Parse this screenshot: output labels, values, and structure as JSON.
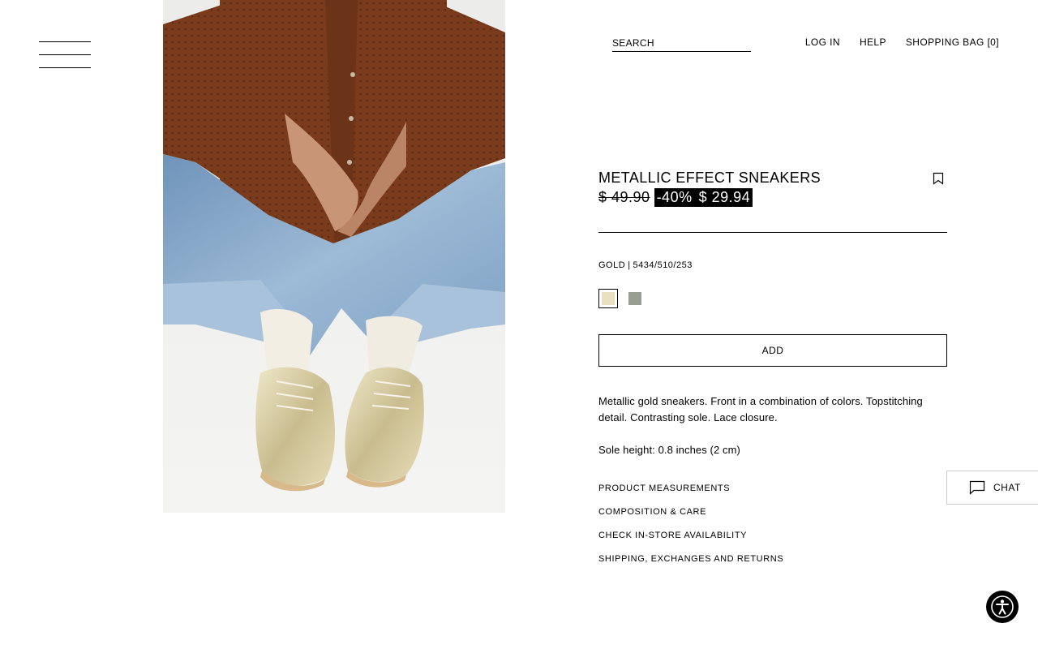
{
  "menu": {
    "icon": "hamburger-menu-icon"
  },
  "header": {
    "search_placeholder": "SEARCH",
    "login": "LOG IN",
    "help": "HELP",
    "bag": "SHOPPING BAG [0]"
  },
  "product": {
    "title": "METALLIC EFFECT SNEAKERS",
    "old_price": "$ 49.90",
    "discount": "-40%",
    "price": "$ 29.94",
    "color_name": "GOLD",
    "separator": "|",
    "reference": "5434/510/253",
    "swatches": [
      {
        "name": "gold",
        "color": "#e8dfbf",
        "selected": true
      },
      {
        "name": "grey",
        "color": "#9a9e92",
        "selected": false
      }
    ],
    "add_label": "ADD",
    "description": "Metallic gold sneakers. Front in a combination of colors. Topstitching detail. Contrasting sole. Lace closure.",
    "sole_height": "Sole height: 0.8 inches (2 cm)",
    "sections": [
      "PRODUCT MEASUREMENTS",
      "COMPOSITION & CARE",
      "CHECK IN-STORE AVAILABILITY",
      "SHIPPING, EXCHANGES AND RETURNS"
    ]
  },
  "chat": {
    "label": "CHAT",
    "icon": "chat-bubble-icon"
  },
  "accessibility": {
    "icon": "accessibility-icon"
  },
  "colors": {
    "text": "#000000",
    "background": "#ffffff",
    "sweater": "#7a3b1c",
    "denim": "#8fb0cf",
    "sock": "#f2eee4",
    "shoe": "#d9cfa6"
  }
}
